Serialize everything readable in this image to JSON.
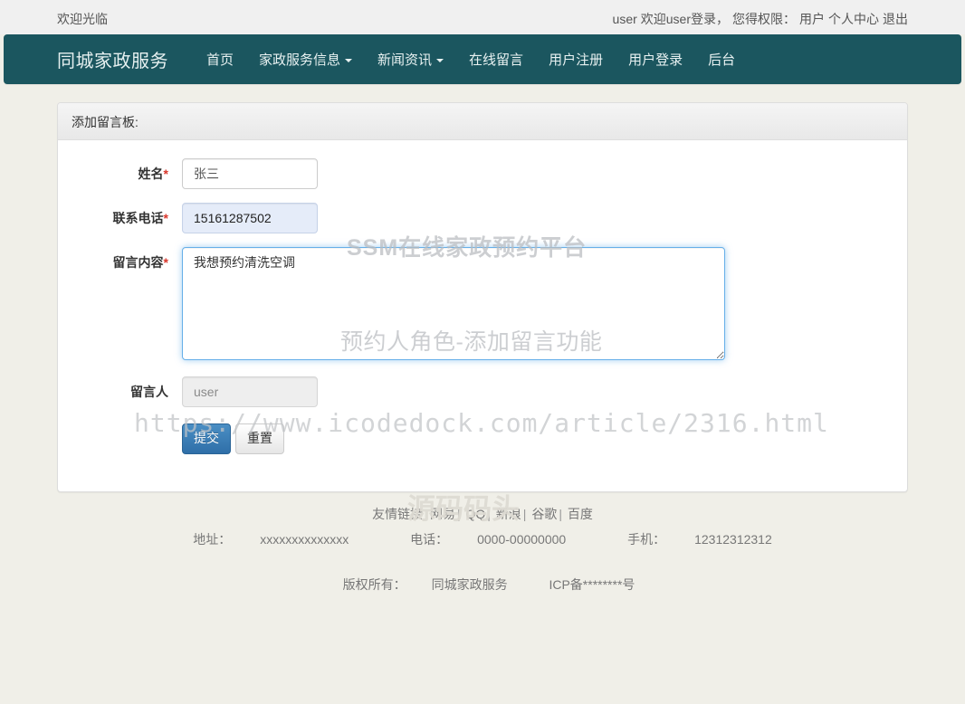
{
  "topbar": {
    "welcome": "欢迎光临",
    "user_prefix": "user",
    "login_text": "欢迎user登录，",
    "role_label": "您得权限：",
    "role_value": "用户",
    "profile_link": "个人中心",
    "logout_link": "退出"
  },
  "navbar": {
    "brand": "同城家政服务",
    "items": [
      {
        "label": "首页",
        "caret": false
      },
      {
        "label": "家政服务信息",
        "caret": true
      },
      {
        "label": "新闻资讯",
        "caret": true
      },
      {
        "label": "在线留言",
        "caret": false
      },
      {
        "label": "用户注册",
        "caret": false
      },
      {
        "label": "用户登录",
        "caret": false
      },
      {
        "label": "后台",
        "caret": false
      }
    ],
    "bg_color": "#1b565f"
  },
  "panel": {
    "heading": "添加留言板:",
    "form": {
      "fields": [
        {
          "label": "姓名",
          "required": true,
          "value": "张三",
          "placeholder": "",
          "state": "normal"
        },
        {
          "label": "联系电话",
          "required": true,
          "value": "15161287502",
          "placeholder": "",
          "state": "autofill"
        },
        {
          "label": "留言内容",
          "required": true,
          "value": "我想预约清洗空调",
          "placeholder": "",
          "state": "focused"
        },
        {
          "label": "留言人",
          "required": false,
          "value": "user",
          "placeholder": "",
          "state": "disabled"
        }
      ],
      "submit_label": "提交",
      "reset_label": "重置"
    }
  },
  "footer": {
    "links_label": "友情链接",
    "links": [
      "网易",
      "QQ",
      "新浪",
      "谷歌",
      "百度"
    ],
    "contact": {
      "address_label": "地址：",
      "address_value": "xxxxxxxxxxxxxx",
      "tel_label": "电话：",
      "tel_value": "0000-00000000",
      "mobile_label": "手机：",
      "mobile_value": "12312312312"
    },
    "copyright_label": "版权所有：",
    "copyright_value": "同城家政服务",
    "icp": "ICP备********号"
  },
  "watermarks": {
    "title": "SSM在线家政预约平台",
    "subtitle": "预约人角色-添加留言功能",
    "url": "https://www.icodedock.com/article/2316.html",
    "brand": "源码码头"
  }
}
